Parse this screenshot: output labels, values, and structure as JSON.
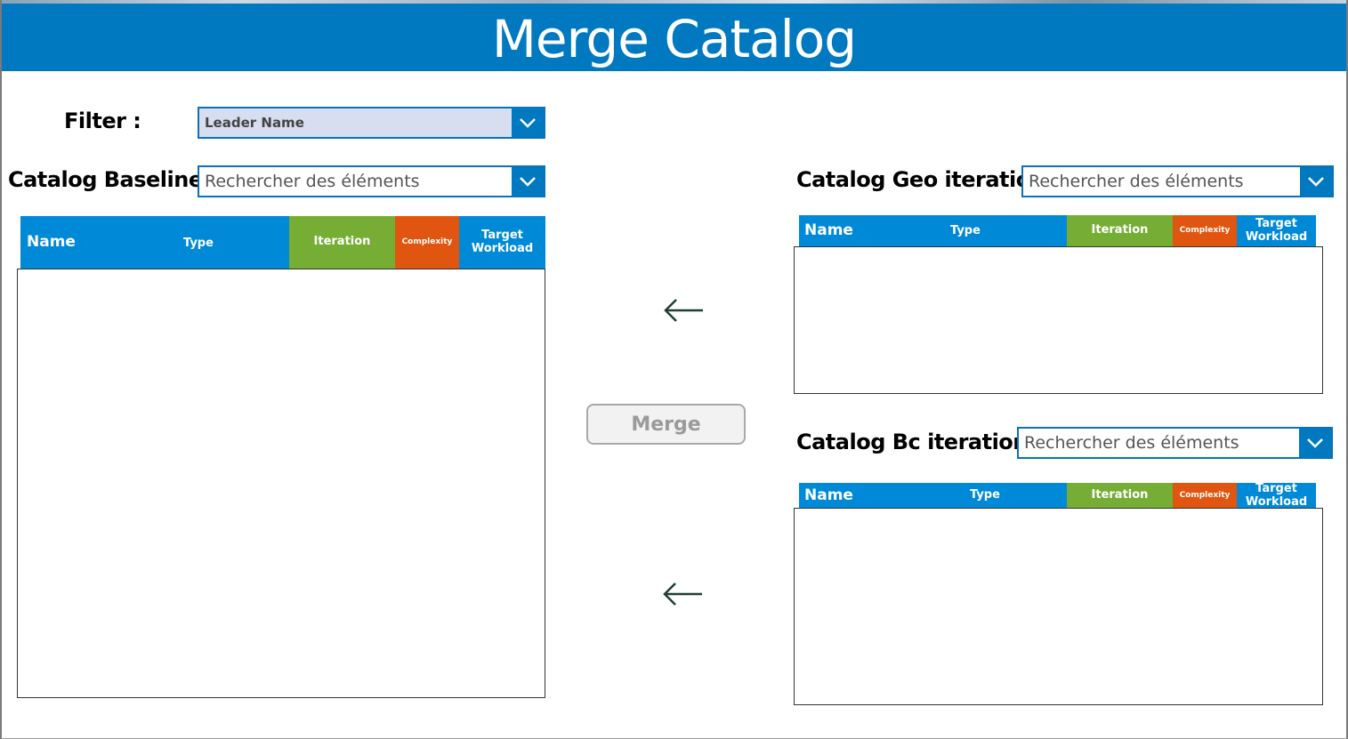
{
  "header": {
    "title": "Merge Catalog"
  },
  "filter": {
    "label": "Filter :",
    "value": "Leader Name"
  },
  "baseline": {
    "label": "Catalog Baseline",
    "search_placeholder": "Rechercher des éléments",
    "columns": {
      "name": "Name",
      "type": "Type",
      "iteration": "Iteration",
      "complexity": "Complexity",
      "target": "Target Workload"
    }
  },
  "geo": {
    "label": "Catalog Geo iteration :",
    "search_placeholder": "Rechercher des éléments",
    "columns": {
      "name": "Name",
      "type": "Type",
      "iteration": "Iteration",
      "complexity": "Complexity",
      "target": "Target Workload"
    }
  },
  "bc": {
    "label": "Catalog Bc iteration :",
    "search_placeholder": "Rechercher des éléments",
    "columns": {
      "name": "Name",
      "type": "Type",
      "iteration": "Iteration",
      "complexity": "Complexity",
      "target": "Target Workload"
    }
  },
  "merge_button": {
    "label": "Merge"
  },
  "colors": {
    "header": "#0079c1",
    "column_blue": "#0089d6",
    "iteration_green": "#76ad35",
    "complexity_orange": "#e0550f"
  },
  "icons": {
    "dropdown": "chevron-down-icon",
    "move_left": "arrow-left-icon"
  }
}
